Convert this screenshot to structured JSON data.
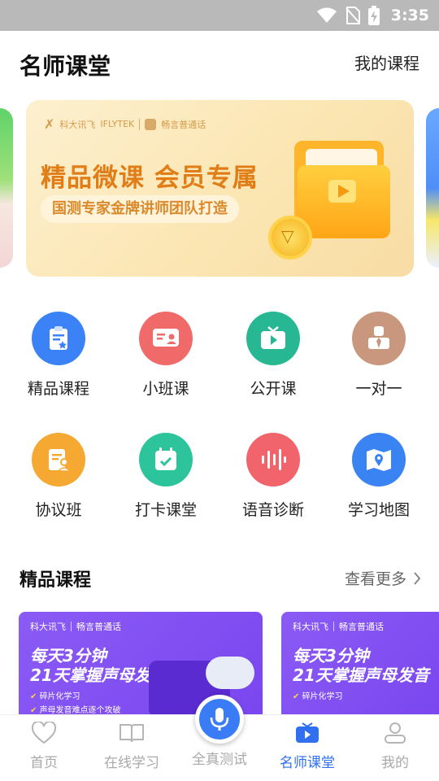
{
  "status_bar": {
    "time": "3:35"
  },
  "header": {
    "title": "名师课堂",
    "my_courses": "我的课程"
  },
  "banner": {
    "logo": "科大讯飞",
    "logo_sub": "IFLYTEK",
    "partner": "畅言普通话",
    "headline": "精品微课 会员专属",
    "subline": "国测专家金牌讲师团队打造"
  },
  "grid": [
    {
      "label": "精品课程",
      "color": "#3b82f6",
      "icon": "clipboard-star-icon"
    },
    {
      "label": "小班课",
      "color": "#f06a6a",
      "icon": "id-card-icon"
    },
    {
      "label": "公开课",
      "color": "#27b893",
      "icon": "tv-play-icon"
    },
    {
      "label": "一对一",
      "color": "#c9967e",
      "icon": "person-tie-icon"
    },
    {
      "label": "协议班",
      "color": "#f6a932",
      "icon": "document-person-icon"
    },
    {
      "label": "打卡课堂",
      "color": "#2dc49b",
      "icon": "calendar-check-icon"
    },
    {
      "label": "语音诊断",
      "color": "#f2646c",
      "icon": "waveform-icon"
    },
    {
      "label": "学习地图",
      "color": "#3a83f3",
      "icon": "map-pin-icon"
    }
  ],
  "section": {
    "title": "精品课程",
    "see_more": "查看更多"
  },
  "courses": [
    {
      "brand": "科大讯飞",
      "partner": "畅言普通话",
      "line1": "每天3分钟",
      "line2": "21天掌握声母发音",
      "tag1": "碎片化学习",
      "tag2": "声母发音难点逐个攻破"
    },
    {
      "brand": "科大讯飞",
      "partner": "畅言普通话",
      "line1": "每天3分钟",
      "line2": "21天掌握声母发音",
      "tag1": "碎片化学习"
    }
  ],
  "bottom_nav": [
    {
      "label": "首页",
      "icon": "heart-icon"
    },
    {
      "label": "在线学习",
      "icon": "book-icon"
    },
    {
      "label": "全真测试",
      "icon": "microphone-icon"
    },
    {
      "label": "名师课堂",
      "icon": "tv-icon",
      "active": true
    },
    {
      "label": "我的",
      "icon": "user-icon"
    }
  ],
  "colors": {
    "accent": "#2f6ff0",
    "nav_inactive": "#a9a9a9"
  }
}
